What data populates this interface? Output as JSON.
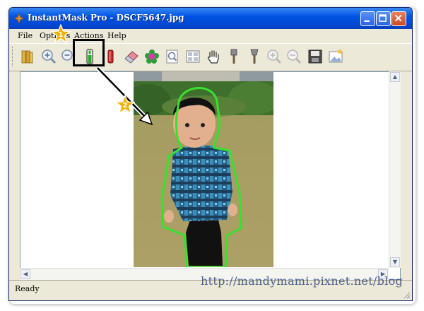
{
  "window": {
    "title": "InstantMask Pro - DSCF5647.jpg",
    "title_color": "#0054e3"
  },
  "menu": {
    "items": [
      "File",
      "Options",
      "Actions",
      "Help"
    ]
  },
  "toolbar": {
    "tools": [
      {
        "icon": "folder-open-icon"
      },
      {
        "icon": "zoom-in-icon"
      },
      {
        "icon": "zoom-out-icon"
      },
      {
        "icon": "green-marker-icon",
        "highlighted": true
      },
      {
        "icon": "red-marker-icon"
      },
      {
        "icon": "eraser-icon"
      },
      {
        "icon": "flower-icon"
      },
      {
        "icon": "magnifier-page-icon"
      },
      {
        "icon": "grid-icon"
      },
      {
        "icon": "hand-pan-icon"
      },
      {
        "icon": "brush-icon"
      },
      {
        "icon": "brush-alt-icon"
      },
      {
        "icon": "zoom-in-disabled-icon"
      },
      {
        "icon": "zoom-out-disabled-icon"
      },
      {
        "icon": "save-icon"
      },
      {
        "icon": "export-image-icon"
      }
    ]
  },
  "annotations": {
    "step1": "1",
    "step2": "2",
    "star_color": "#f0b400",
    "box_color": "#000000"
  },
  "status": {
    "text": "Ready"
  },
  "watermark": {
    "text": "http://mandymami.pixnet.net/blog"
  },
  "colors": {
    "mask_outline": "#39e02f"
  }
}
